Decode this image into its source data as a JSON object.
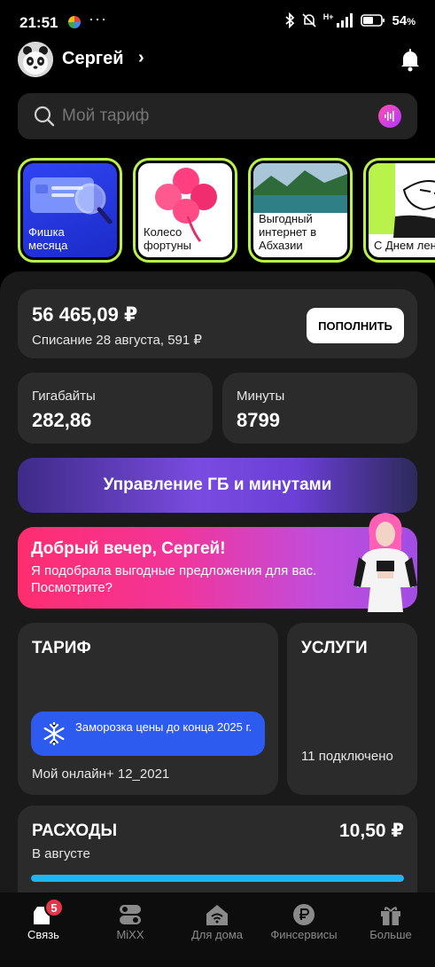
{
  "status_bar": {
    "time": "21:51",
    "dots": "···",
    "network": "H+",
    "battery": "54"
  },
  "header": {
    "user_name": "Сергей",
    "chevron": "›"
  },
  "search": {
    "placeholder": "Мой тариф"
  },
  "stories": [
    {
      "label": "Фишка месяца"
    },
    {
      "label": "Колесо фортуны"
    },
    {
      "label": "Выгодный интернет в Абхазии"
    },
    {
      "label": "С Днем лен"
    }
  ],
  "balance": {
    "value": "56 465,09 ₽",
    "charge_text": "Списание 28 августа, 591 ₽",
    "topup_label": "ПОПОЛНИТЬ"
  },
  "gigabytes": {
    "label": "Гигабайты",
    "value": "282,86"
  },
  "minutes": {
    "label": "Минуты",
    "value": "8799"
  },
  "manage": {
    "label": "Управление ГБ и минутами"
  },
  "promo": {
    "title": "Добрый вечер, Сергей!",
    "text": "Я подобрала выгодные предложения для вас. Посмотрите?"
  },
  "tariff": {
    "title": "ТАРИФ",
    "freeze_text": "Заморозка цены до конца 2025 г.",
    "name": "Мой онлайн+ 12_2021"
  },
  "services": {
    "title": "УСЛУГИ",
    "count_text": "11 подключено"
  },
  "expenses": {
    "title": "РАСХОДЫ",
    "value": "10,50 ₽",
    "period": "В августе",
    "bar_fraction": 1.0
  },
  "nav": {
    "items": [
      {
        "label": "Связь",
        "icon": "sim-card-icon",
        "active": true,
        "badge": "5"
      },
      {
        "label": "MiXX",
        "icon": "mixx-icon"
      },
      {
        "label": "Для дома",
        "icon": "home-wifi-icon"
      },
      {
        "label": "Финсервисы",
        "icon": "ruble-icon"
      },
      {
        "label": "Больше",
        "icon": "gift-icon"
      }
    ]
  },
  "colors": {
    "accent_green": "#b8f24a",
    "freeze_blue": "#2d5bf0",
    "bar_blue": "#1fb4f4",
    "badge_red": "#e6344a"
  }
}
